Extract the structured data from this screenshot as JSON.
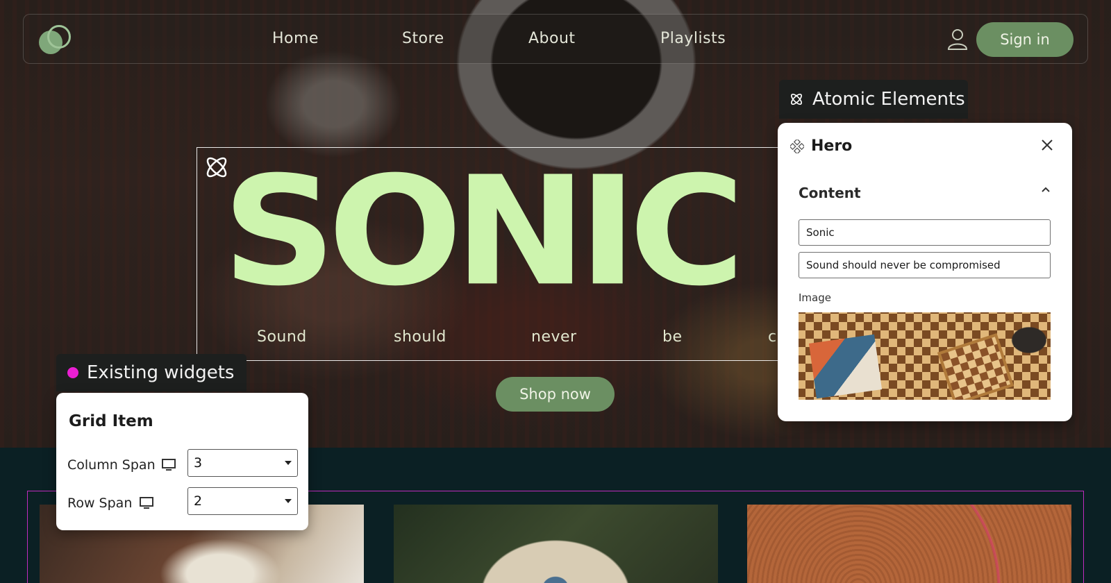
{
  "nav": {
    "links": [
      "Home",
      "Store",
      "About",
      "Playlists"
    ],
    "signin_label": "Sign in"
  },
  "hero": {
    "title": "SONIC",
    "subtitle_words": [
      "Sound",
      "should",
      "never",
      "be",
      "c"
    ],
    "cta_label": "Shop now"
  },
  "widgets_tag": {
    "label": "Existing widgets",
    "dot_color": "#ea1fd3"
  },
  "grid_item_panel": {
    "title": "Grid Item",
    "column_span_label": "Column Span",
    "column_span_value": "3",
    "row_span_label": "Row Span",
    "row_span_value": "2"
  },
  "atomic_tag": {
    "label": "Atomic Elements"
  },
  "hero_panel": {
    "title": "Hero",
    "section_title": "Content",
    "title_field_value": "Sonic",
    "subtitle_field_value": "Sound should never be compromised",
    "image_label": "Image"
  },
  "colors": {
    "accent_green": "#6b8f62",
    "hero_title_green": "#cdf4ae",
    "section_bg": "#0b2024",
    "grid_frame_magenta": "#c02cbf"
  }
}
